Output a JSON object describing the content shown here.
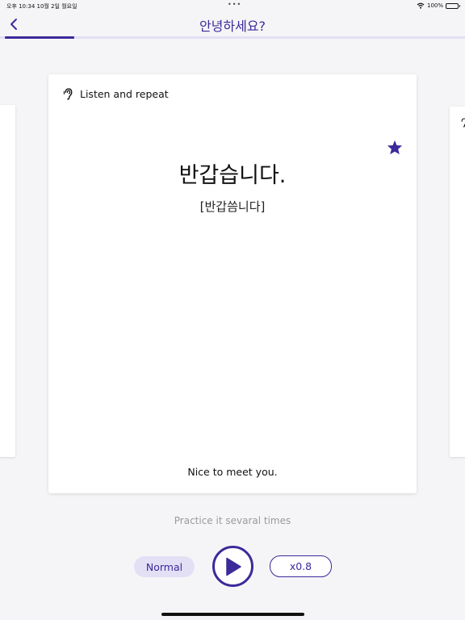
{
  "status_bar": {
    "time_date": "오후 10:34   10월 2일 월요일",
    "dots": "•••",
    "battery_text": "100%"
  },
  "header": {
    "title": "안녕하세요?",
    "progress": 0.15
  },
  "card": {
    "mode_label": "Listen and repeat",
    "phrase": "반갑습니다.",
    "pronunciation": "[반갑씀니다]",
    "translation": "Nice to meet you.",
    "favorited": true
  },
  "controls": {
    "hint": "Practice it sevaral times",
    "speed_normal_label": "Normal",
    "speed_slow_label": "x0.8"
  },
  "colors": {
    "accent": "#3b2a9a",
    "accent_light": "#e3e0f5",
    "background": "#f5f5f7"
  },
  "icons": {
    "back": "chevron-left-icon",
    "listen": "ear-icon",
    "favorite": "star-icon",
    "play": "play-icon",
    "wifi": "wifi-icon",
    "battery": "battery-icon"
  }
}
